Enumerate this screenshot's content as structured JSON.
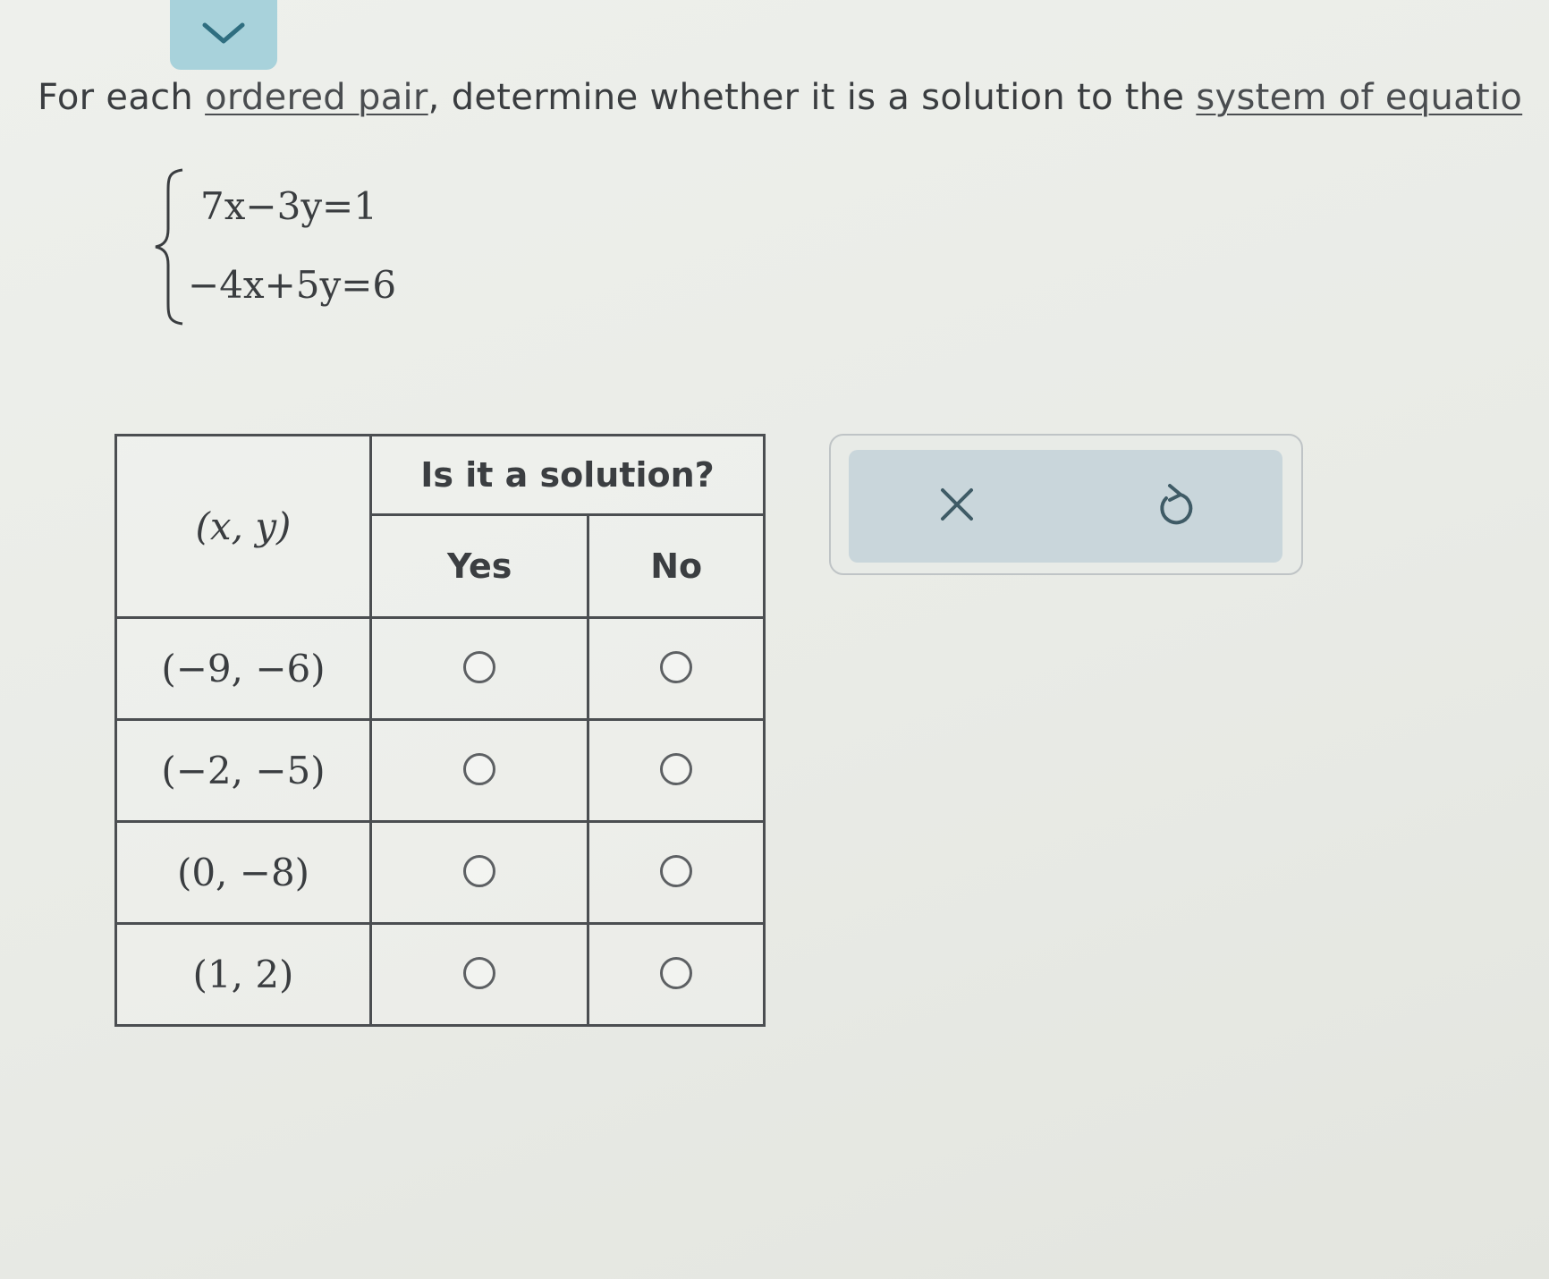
{
  "toggle": {
    "icon": "chevron-down-icon"
  },
  "prompt": {
    "before": "For each ",
    "link1": "ordered pair",
    "middle": ", determine whether it is a solution to the ",
    "link2": "system of equatio"
  },
  "system": {
    "equation1": "7x−3y=1",
    "equation2": "−4x+5y=6"
  },
  "table": {
    "header_main": "Is it a solution?",
    "header_xy": "(x, y)",
    "header_yes": "Yes",
    "header_no": "No",
    "rows": [
      {
        "pair": "(−9, −6)"
      },
      {
        "pair": "(−2, −5)"
      },
      {
        "pair": "(0, −8)"
      },
      {
        "pair": "(1, 2)"
      }
    ]
  },
  "actions": {
    "clear_icon": "close-icon",
    "undo_icon": "undo-icon"
  },
  "colors": {
    "toggle_bg": "#a8d2db",
    "action_bg": "#c9d6db",
    "border": "#4b4e51"
  }
}
